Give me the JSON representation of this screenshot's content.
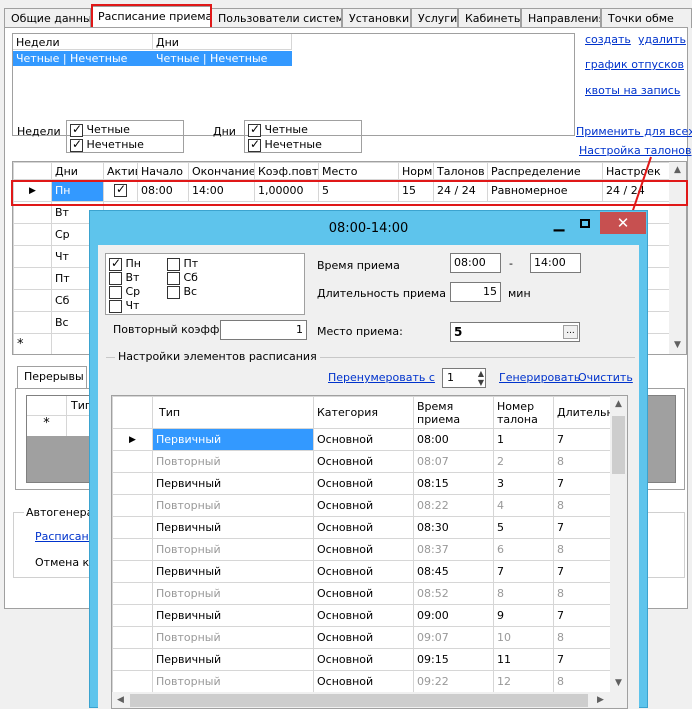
{
  "tabs": [
    "Общие данные",
    "Расписание приема",
    "Пользователи системы",
    "Установки",
    "Услуги",
    "Кабинеты",
    "Направления",
    "Точки обме"
  ],
  "weeks_table": {
    "headers": [
      "Недели",
      "Дни"
    ],
    "row": [
      "Четные | Нечетные",
      "Четные | Нечетные"
    ]
  },
  "links": {
    "create": "создать",
    "delete": "удалить",
    "vacation": "график отпусков",
    "quotas": "квоты на запись",
    "apply_all": "Применить для всех",
    "ticket_settings": "Настройка талонов"
  },
  "weeks_group": {
    "label": "Недели",
    "even": "Четные",
    "odd": "Нечетные"
  },
  "days_group": {
    "label": "Дни",
    "even": "Четные",
    "odd": "Нечетные"
  },
  "schedule": {
    "headers": [
      "Дни",
      "Актив",
      "Начало",
      "Окончание",
      "Коэф.повт.",
      "Место",
      "Норм",
      "Талонов",
      "Распределение",
      "Настроек"
    ],
    "row1": {
      "day": "Пн",
      "start": "08:00",
      "end": "14:00",
      "coef": "1,00000",
      "place": "5",
      "norm": "15",
      "tickets": "24 / 24",
      "dist": "Равномерное",
      "settings": "24 / 24"
    },
    "days": [
      "Вт",
      "Ср",
      "Чт",
      "Пт",
      "Сб",
      "Вс"
    ],
    "new_row": "*"
  },
  "breaks_tab": "Перерывы",
  "breaks_col": "Тип",
  "autogen": {
    "title": "Автогенерац",
    "link": "Расписани",
    "cancel": "Отмена кв"
  },
  "dialog": {
    "title": "08:00-14:00",
    "days": [
      "Пн",
      "Вт",
      "Ср",
      "Чт",
      "Пт",
      "Сб",
      "Вс"
    ],
    "time_label": "Время приема",
    "time_from": "08:00",
    "time_dash": "-",
    "time_to": "14:00",
    "duration_label": "Длительность приема",
    "duration": "15",
    "duration_unit": "мин",
    "coef_label": "Повторный коэфф.",
    "coef": "1",
    "place_label": "Место приема:",
    "place": "5",
    "place_btn": "...",
    "group_title": "Настройки элементов расписания",
    "renumber": "Перенумеровать с",
    "renumber_val": "1",
    "generate": "Генерировать",
    "clear": "Очистить",
    "grid_headers": [
      "Тип",
      "Категория",
      "Время приема",
      "Номер талона",
      "Длительно"
    ],
    "rows": [
      {
        "type": "Первичный",
        "cat": "Основной",
        "time": "08:00",
        "num": "1",
        "dur": "7"
      },
      {
        "type": "Повторный",
        "cat": "Основной",
        "time": "08:07",
        "num": "2",
        "dur": "8"
      },
      {
        "type": "Первичный",
        "cat": "Основной",
        "time": "08:15",
        "num": "3",
        "dur": "7"
      },
      {
        "type": "Повторный",
        "cat": "Основной",
        "time": "08:22",
        "num": "4",
        "dur": "8"
      },
      {
        "type": "Первичный",
        "cat": "Основной",
        "time": "08:30",
        "num": "5",
        "dur": "7"
      },
      {
        "type": "Повторный",
        "cat": "Основной",
        "time": "08:37",
        "num": "6",
        "dur": "8"
      },
      {
        "type": "Первичный",
        "cat": "Основной",
        "time": "08:45",
        "num": "7",
        "dur": "7"
      },
      {
        "type": "Повторный",
        "cat": "Основной",
        "time": "08:52",
        "num": "8",
        "dur": "8"
      },
      {
        "type": "Первичный",
        "cat": "Основной",
        "time": "09:00",
        "num": "9",
        "dur": "7"
      },
      {
        "type": "Повторный",
        "cat": "Основной",
        "time": "09:07",
        "num": "10",
        "dur": "8"
      },
      {
        "type": "Первичный",
        "cat": "Основной",
        "time": "09:15",
        "num": "11",
        "dur": "7"
      },
      {
        "type": "Повторный",
        "cat": "Основной",
        "time": "09:22",
        "num": "12",
        "dur": "8"
      }
    ]
  },
  "colors": {
    "selection": "#3399ff",
    "titlebar": "#5ec4ec",
    "close": "#c75050",
    "highlight": "#e01818"
  }
}
